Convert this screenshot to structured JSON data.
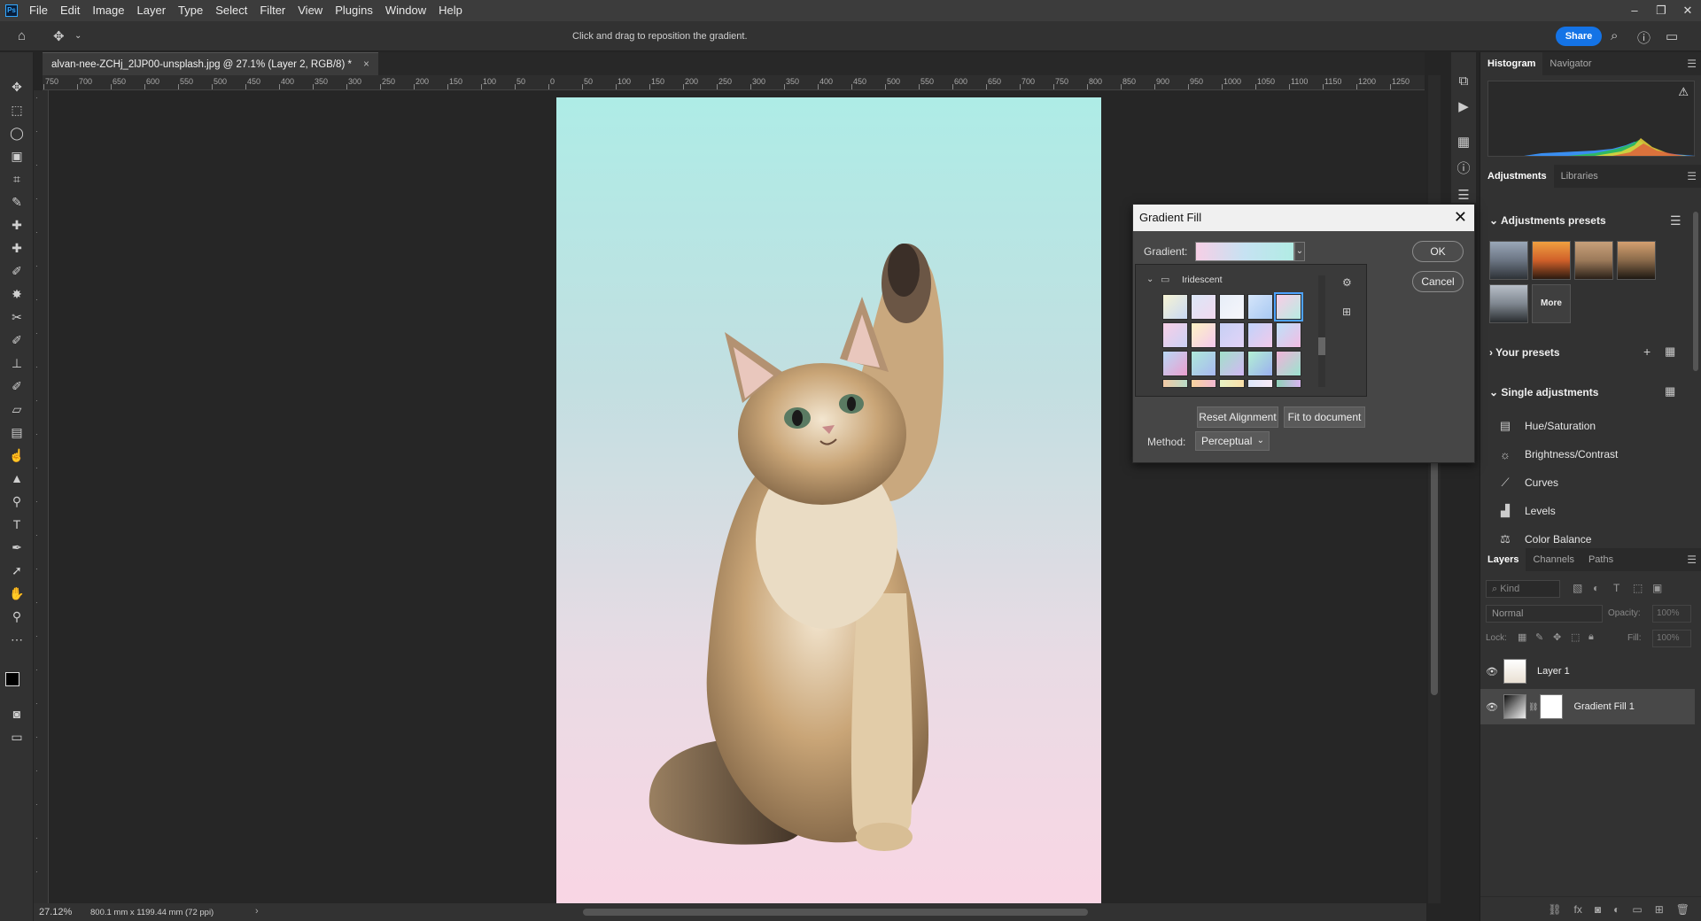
{
  "app": {
    "logo_text": "Ps"
  },
  "menu": [
    "File",
    "Edit",
    "Image",
    "Layer",
    "Type",
    "Select",
    "Filter",
    "View",
    "Plugins",
    "Window",
    "Help"
  ],
  "options_bar": {
    "hint": "Click and drag to reposition the gradient.",
    "share_label": "Share"
  },
  "document_tab": {
    "title": "alvan-nee-ZCHj_2lJP00-unsplash.jpg @ 27.1% (Layer 2, RGB/8) *",
    "close": "×"
  },
  "ruler_top": [
    "750",
    "700",
    "650",
    "600",
    "550",
    "500",
    "450",
    "400",
    "350",
    "300",
    "250",
    "200",
    "150",
    "100",
    "50",
    "0",
    "50",
    "100",
    "150",
    "200",
    "250",
    "300",
    "350",
    "400",
    "450",
    "500",
    "550",
    "600",
    "650",
    "700",
    "750",
    "800",
    "850",
    "900",
    "950",
    "1000",
    "1050",
    "1100",
    "1150",
    "1200",
    "1250"
  ],
  "status": {
    "zoom": "27.12%",
    "dimensions": "800.1 mm x 1199.44 mm (72 ppi)"
  },
  "histogram_panel": {
    "tabs": [
      "Histogram",
      "Navigator"
    ]
  },
  "adjustments_panel": {
    "tabs": [
      "Adjustments",
      "Libraries"
    ],
    "presets_title": "Adjustments presets",
    "more_label": "More",
    "your_presets": "Your presets",
    "single_adjustments": "Single adjustments",
    "items": [
      {
        "label": "Hue/Saturation",
        "icon": "hue-saturation-icon"
      },
      {
        "label": "Brightness/Contrast",
        "icon": "brightness-icon"
      },
      {
        "label": "Curves",
        "icon": "curves-icon"
      },
      {
        "label": "Levels",
        "icon": "levels-icon"
      },
      {
        "label": "Color Balance",
        "icon": "color-balance-icon"
      }
    ]
  },
  "layers_panel": {
    "tabs": [
      "Layers",
      "Channels",
      "Paths"
    ],
    "kind_placeholder": "Kind",
    "blend_mode": "Normal",
    "opacity_label": "Opacity:",
    "opacity_value": "100%",
    "lock_label": "Lock:",
    "fill_label": "Fill:",
    "fill_value": "100%",
    "layers": [
      {
        "name": "Layer 1"
      },
      {
        "name": "Gradient Fill 1"
      }
    ]
  },
  "dialog": {
    "title": "Gradient Fill",
    "gradient_label": "Gradient:",
    "ok": "OK",
    "cancel": "Cancel",
    "folder": "Iridescent",
    "reset_alignment": "Reset Alignment",
    "fit_to_document": "Fit to document",
    "method_label": "Method:",
    "method_value": "Perceptual"
  },
  "colors": {
    "accent": "#1473e6",
    "gradient_top": "#aeece6",
    "gradient_bottom": "#f9d6e4"
  }
}
